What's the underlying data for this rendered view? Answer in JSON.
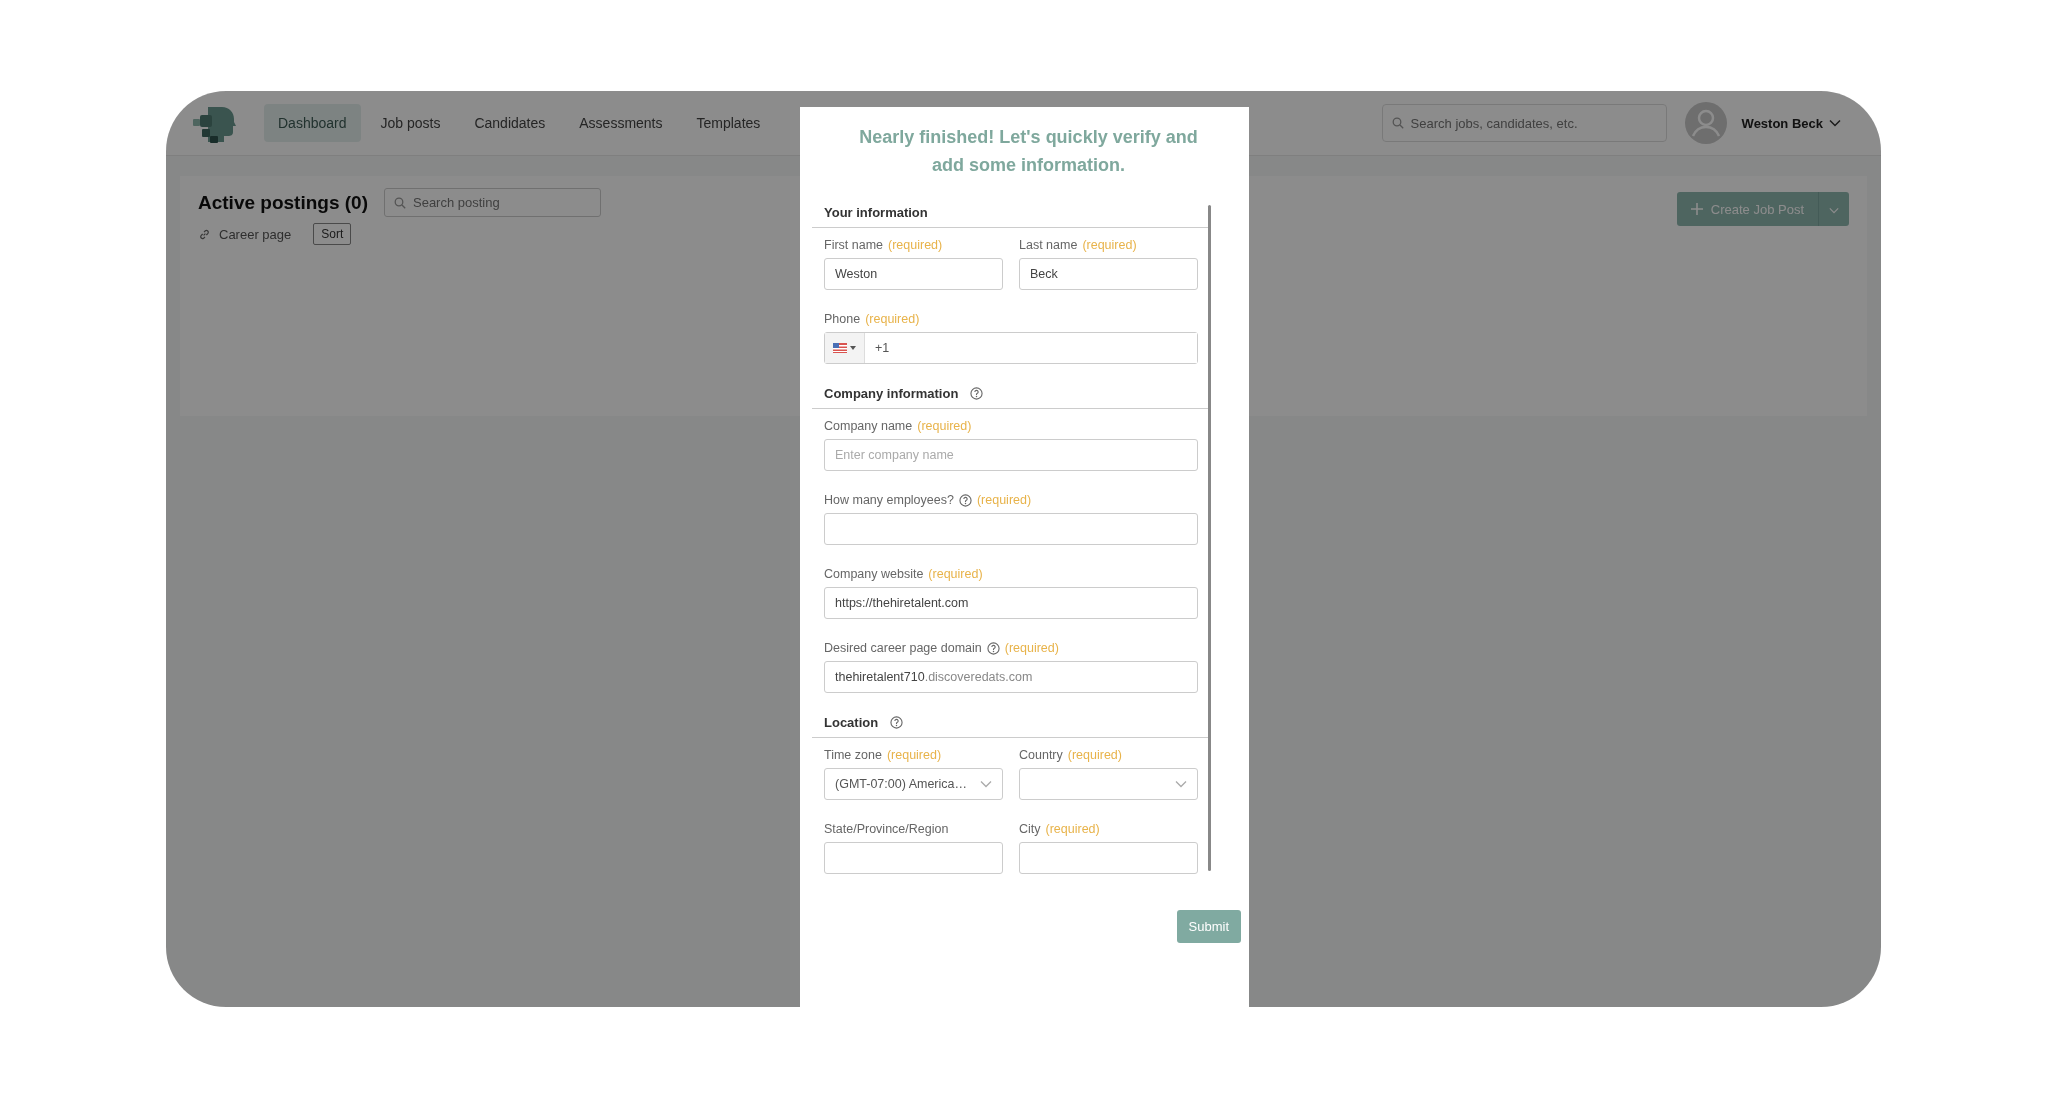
{
  "nav": {
    "tabs": [
      {
        "label": "Dashboard",
        "selected": true
      },
      {
        "label": "Job posts",
        "selected": false
      },
      {
        "label": "Candidates",
        "selected": false
      },
      {
        "label": "Assessments",
        "selected": false
      },
      {
        "label": "Templates",
        "selected": false
      }
    ],
    "search": {
      "placeholder": "Search jobs, candidates, etc."
    },
    "user": {
      "name": "Weston Beck"
    }
  },
  "postings": {
    "title": "Active postings (0)",
    "search": {
      "placeholder": "Search posting"
    },
    "career_link": "Career page",
    "sort_button": "Sort",
    "create_button": "Create Job Post"
  },
  "modal": {
    "heading": "Nearly finished! Let's quickly verify and add some information.",
    "sections": [
      {
        "title": "Your information",
        "help": false,
        "rows": [
          [
            {
              "kind": "text",
              "label": "First name",
              "help": false,
              "note": "(required)",
              "value": "Weston"
            },
            {
              "kind": "text",
              "label": "Last name",
              "help": false,
              "note": "(required)",
              "value": "Beck"
            }
          ],
          [
            {
              "kind": "phone",
              "label": "Phone",
              "help": false,
              "note": "(required)",
              "value": "+1"
            }
          ]
        ]
      },
      {
        "title": "Company information",
        "help": true,
        "rows": [
          [
            {
              "kind": "text",
              "label": "Company name",
              "help": false,
              "note": "(required)",
              "placeholder": "Enter company name"
            }
          ],
          [
            {
              "kind": "text",
              "label": "How many employees?",
              "help": true,
              "note": "(required)"
            }
          ],
          [
            {
              "kind": "text",
              "label": "Company website",
              "help": false,
              "note": "(required)",
              "value": "https://thehiretalent.com"
            }
          ],
          [
            {
              "kind": "domain",
              "label": "Desired career page domain",
              "help": true,
              "note": "(required)",
              "value": "thehiretalent710",
              "suffix": ".discoveredats.com"
            }
          ]
        ]
      },
      {
        "title": "Location",
        "help": true,
        "rows": [
          [
            {
              "kind": "select",
              "label": "Time zone",
              "help": false,
              "note": "(required)",
              "value": "(GMT-07:00) America…"
            },
            {
              "kind": "select",
              "label": "Country",
              "help": false,
              "note": "(required)"
            }
          ],
          [
            {
              "kind": "text",
              "label": "State/Province/Region",
              "help": false
            },
            {
              "kind": "text",
              "label": "City",
              "help": false,
              "note": "(required)"
            }
          ]
        ]
      }
    ],
    "submit": "Submit"
  }
}
